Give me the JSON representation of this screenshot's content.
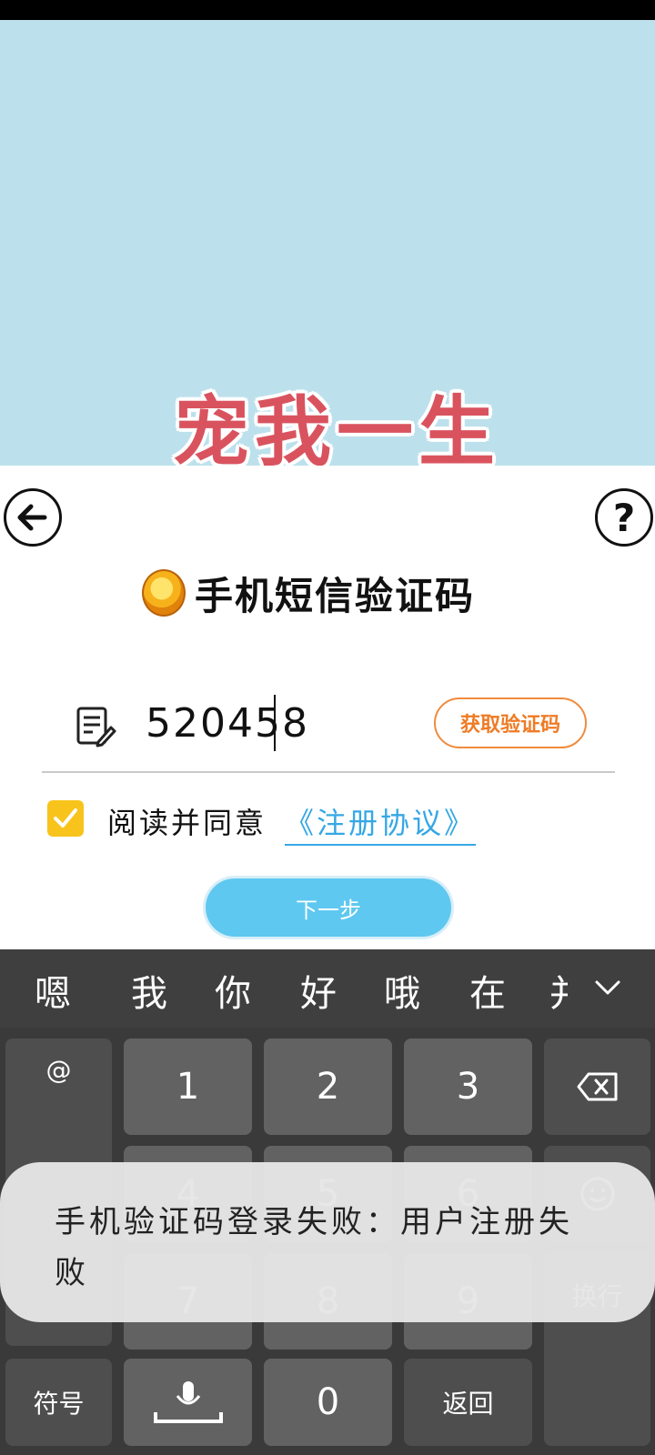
{
  "logo_text": "宠我一生",
  "header": {
    "title": "手机短信验证码"
  },
  "form": {
    "code_value": "520458",
    "get_code_label": "获取验证码",
    "agree_text": "阅读并同意",
    "agreement_link": "《注册协议》",
    "next_label": "下一步"
  },
  "keyboard": {
    "candidates": [
      "嗯",
      "我",
      "你",
      "好",
      "哦",
      "在",
      "并"
    ],
    "keys": {
      "at": "@",
      "k1": "1",
      "k2": "2",
      "k3": "3",
      "k4": "4",
      "k5": "5",
      "k6": "6",
      "k7": "7",
      "k8": "8",
      "k9": "9",
      "k0": "0",
      "symbols": "符号",
      "return": "返回",
      "newline": "换行"
    }
  },
  "toast": {
    "message": "手机验证码登录失败：用户注册失败"
  }
}
